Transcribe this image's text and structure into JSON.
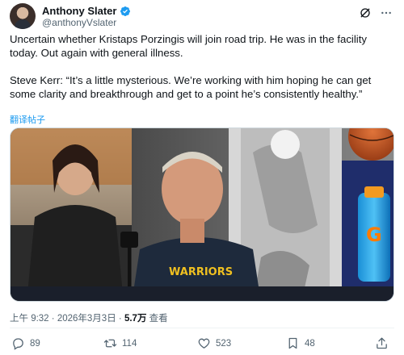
{
  "author": {
    "name": "Anthony Slater",
    "handle": "@anthonyVslater"
  },
  "tweet": {
    "paragraph1": "Uncertain whether Kristaps Porzingis will join road trip. He was in the facility today. Out again with general illness.",
    "paragraph2": "Steve Kerr: “It’s a little mysterious. We’re working with him hoping he can get some clarity and breakthrough and get to a point he’s consistently healthy.”",
    "translate_label": "翻译帖子"
  },
  "media": {
    "description_icon": "photo",
    "shirt_text": "WARRIORS",
    "bottle_text": "G"
  },
  "meta": {
    "time": "上午 9:32",
    "separator": "·",
    "date": "2026年3月3日",
    "views_count": "5.7万",
    "views_label": "查看"
  },
  "actions": {
    "replies": "89",
    "reposts": "114",
    "likes": "523",
    "bookmarks": "48"
  },
  "colors": {
    "link": "#1d9bf0",
    "secondary": "#536471",
    "verified": "#1d9bf0"
  }
}
